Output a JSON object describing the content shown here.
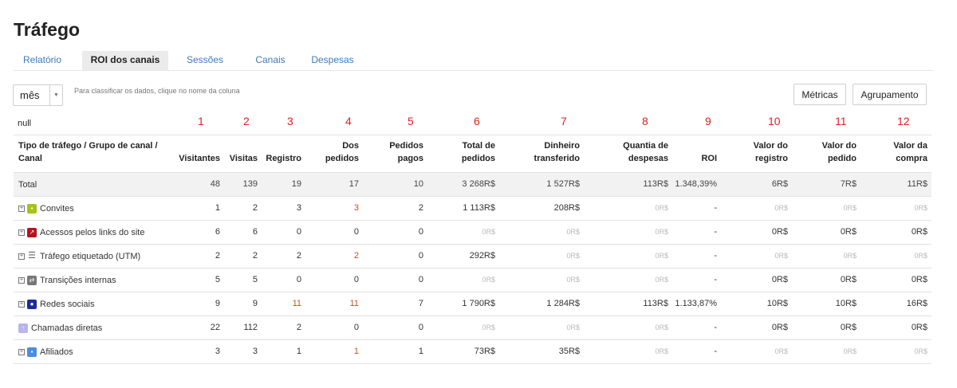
{
  "title": "Tráfego",
  "tabs": [
    "Relatório",
    "ROI dos canais",
    "Sessões",
    "Canais",
    "Despesas"
  ],
  "active_tab": "ROI dos canais",
  "period": {
    "value": "mês"
  },
  "hint": "Para classificar os dados, clique no nome da coluna",
  "buttons": {
    "metrics": "Métricas",
    "grouping": "Agrupamento"
  },
  "null_label": "null",
  "column_numbers": [
    "1",
    "2",
    "3",
    "4",
    "5",
    "6",
    "7",
    "8",
    "9",
    "10",
    "11",
    "12"
  ],
  "headers": {
    "name": "Tipo de tráfego / Grupo de canal / Canal",
    "visitantes": "Visitantes",
    "visitas": "Visitas",
    "registro": "Registro",
    "dos_pedidos": "Dos pedidos",
    "pedidos_pagos": "Pedidos pagos",
    "total_pedidos": "Total de pedidos",
    "dinheiro": "Dinheiro transferido",
    "despesas": "Quantia de despesas",
    "roi": "ROI",
    "valor_registro": "Valor do registro",
    "valor_pedido": "Valor do pedido",
    "valor_compra": "Valor da compra"
  },
  "total": {
    "name": "Total",
    "values": [
      "48",
      "139",
      "19",
      "17",
      "10",
      "3 268R$",
      "1 527R$",
      "113R$",
      "1.348,39%",
      "6R$",
      "7R$",
      "11R$"
    ]
  },
  "rows": [
    {
      "name": "Convites",
      "icon": "chat-bubble-icon",
      "icon_color": "#a3c416",
      "expandable": true,
      "values": [
        "1",
        "2",
        "3",
        "3",
        "2",
        "1 113R$",
        "208R$",
        "0R$",
        "-",
        "0R$",
        "0R$",
        "0R$"
      ]
    },
    {
      "name": "Acessos pelos links do site",
      "icon": "external-link-icon",
      "icon_color": "#b3141e",
      "expandable": true,
      "values": [
        "6",
        "6",
        "0",
        "0",
        "0",
        "0R$",
        "0R$",
        "0R$",
        "-",
        "0R$",
        "0R$",
        "0R$"
      ]
    },
    {
      "name": "Tráfego etiquetado (UTM)",
      "icon": "list-icon",
      "icon_color": "#666666",
      "expandable": true,
      "values": [
        "2",
        "2",
        "2",
        "2",
        "0",
        "292R$",
        "0R$",
        "0R$",
        "-",
        "0R$",
        "0R$",
        "0R$"
      ]
    },
    {
      "name": "Transições internas",
      "icon": "transfer-icon",
      "icon_color": "#777777",
      "expandable": true,
      "values": [
        "5",
        "5",
        "0",
        "0",
        "0",
        "0R$",
        "0R$",
        "0R$",
        "-",
        "0R$",
        "0R$",
        "0R$"
      ]
    },
    {
      "name": "Redes sociais",
      "icon": "people-icon",
      "icon_color": "#1d2a9e",
      "expandable": true,
      "values": [
        "9",
        "9",
        "11",
        "11",
        "7",
        "1 790R$",
        "1 284R$",
        "113R$",
        "1.133,87%",
        "10R$",
        "10R$",
        "16R$"
      ]
    },
    {
      "name": "Chamadas diretas",
      "icon": "arrow-up-icon",
      "icon_color": "#b9b4ea",
      "expandable": false,
      "values": [
        "22",
        "112",
        "2",
        "0",
        "0",
        "0R$",
        "0R$",
        "0R$",
        "-",
        "0R$",
        "0R$",
        "0R$"
      ]
    },
    {
      "name": "Afiliados",
      "icon": "speech-bubble-icon",
      "icon_color": "#4a8ee0",
      "expandable": true,
      "values": [
        "3",
        "3",
        "1",
        "1",
        "1",
        "73R$",
        "35R$",
        "0R$",
        "-",
        "0R$",
        "0R$",
        "0R$"
      ]
    }
  ],
  "colors": {
    "link": "#3d7ab8",
    "marker": "#e0201e",
    "accent_value": "#c0521e",
    "muted": "#b8b8b8"
  }
}
